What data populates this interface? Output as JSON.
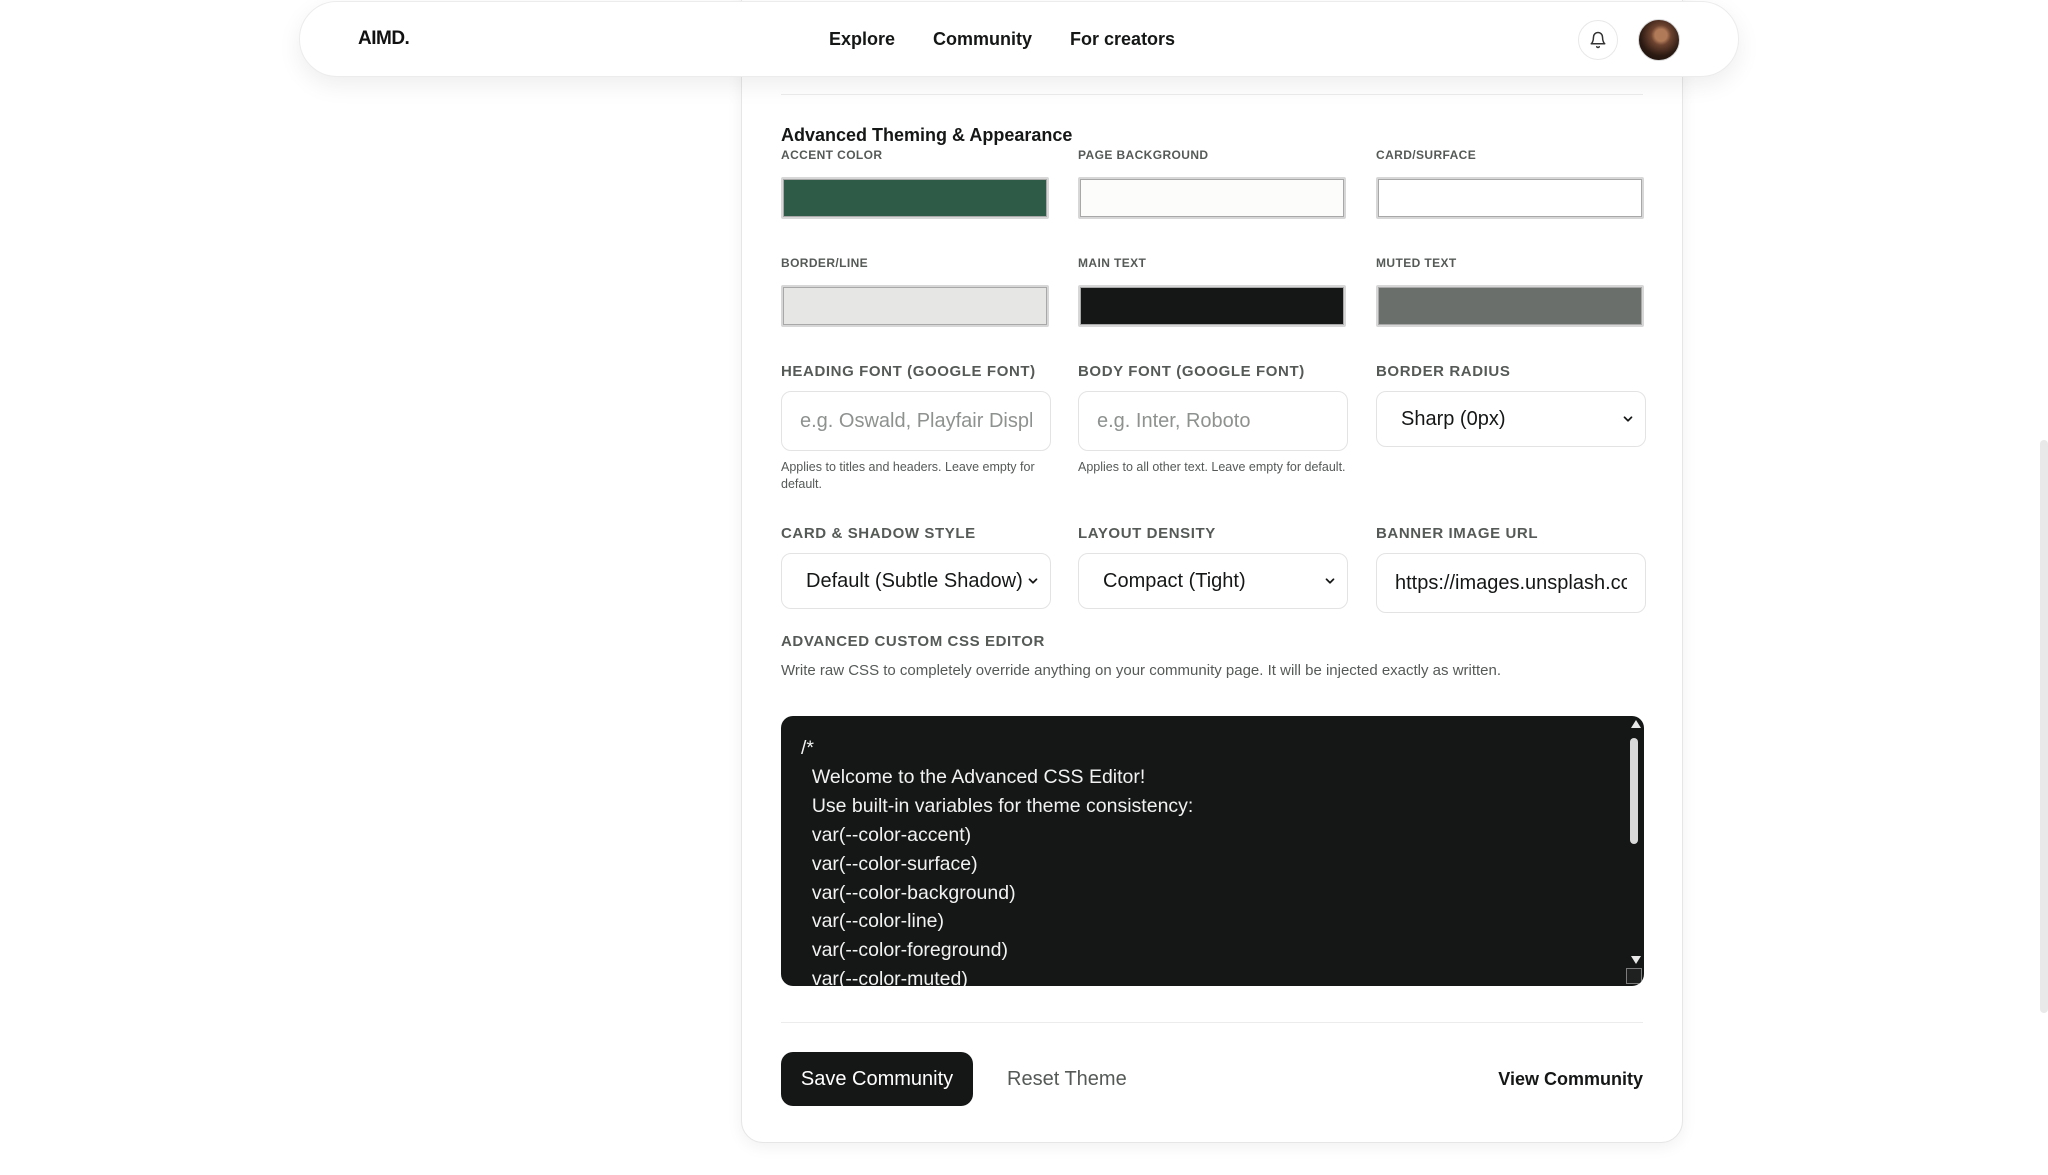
{
  "nav": {
    "brand": "AIMD.",
    "links": [
      "Explore",
      "Community",
      "For creators"
    ]
  },
  "section": {
    "title": "Advanced Theming & Appearance"
  },
  "colors": [
    {
      "label": "ACCENT COLOR",
      "value": "#2e5a48"
    },
    {
      "label": "PAGE BACKGROUND",
      "value": "#fcfcfb"
    },
    {
      "label": "CARD/SURFACE",
      "value": "#ffffff"
    },
    {
      "label": "BORDER/LINE",
      "value": "#e6e6e4"
    },
    {
      "label": "MAIN TEXT",
      "value": "#151716"
    },
    {
      "label": "MUTED TEXT",
      "value": "#6b6f6c"
    }
  ],
  "fields": {
    "heading_font": {
      "label": "HEADING FONT (GOOGLE FONT)",
      "placeholder": "e.g. Oswald, Playfair Display",
      "help": "Applies to titles and headers. Leave empty for default."
    },
    "body_font": {
      "label": "BODY FONT (GOOGLE FONT)",
      "placeholder": "e.g. Inter, Roboto",
      "help": "Applies to all other text. Leave empty for default."
    },
    "border_radius": {
      "label": "BORDER RADIUS",
      "value": "Sharp (0px)"
    },
    "card_style": {
      "label": "CARD & SHADOW STYLE",
      "value": "Default (Subtle Shadow)"
    },
    "layout_density": {
      "label": "LAYOUT DENSITY",
      "value": "Compact (Tight)"
    },
    "banner_url": {
      "label": "BANNER IMAGE URL",
      "value": "https://images.unsplash.com"
    }
  },
  "css_editor": {
    "label": "ADVANCED CUSTOM CSS EDITOR",
    "description": "Write raw CSS to completely override anything on your community page. It will be injected exactly as written.",
    "code": "/*\n  Welcome to the Advanced CSS Editor!\n  Use built-in variables for theme consistency:\n  var(--color-accent)\n  var(--color-surface)\n  var(--color-background)\n  var(--color-line)\n  var(--color-foreground)\n  var(--color-muted)"
  },
  "actions": {
    "save": "Save Community",
    "reset": "Reset Theme",
    "view": "View Community"
  }
}
